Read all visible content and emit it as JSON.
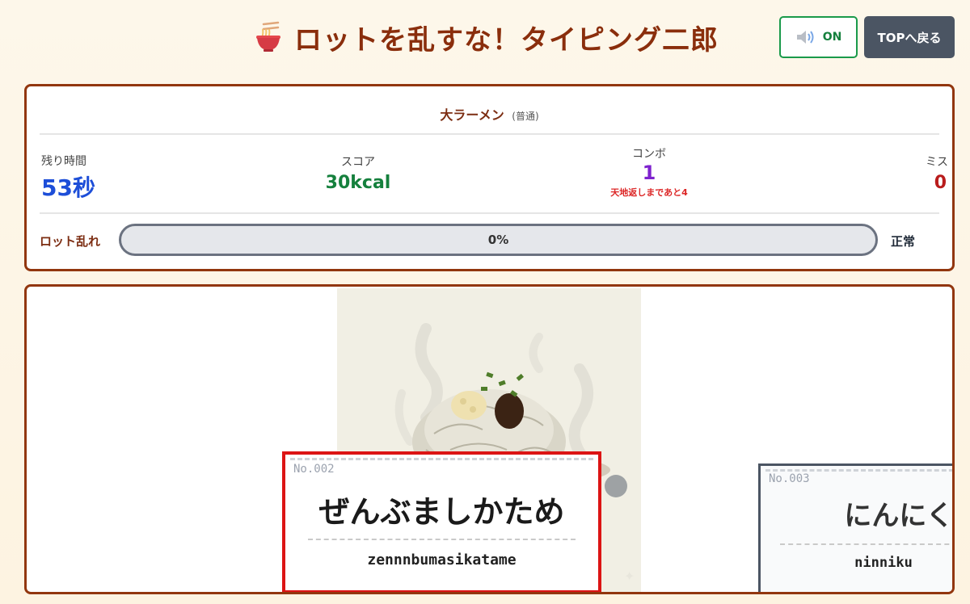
{
  "header": {
    "title": "ロットを乱すな！タイピング二郎",
    "sound_label": "ON",
    "top_button_label": "TOPへ戻る"
  },
  "status": {
    "course_name": "大ラーメン",
    "course_level": "(普通)",
    "time_label": "残り時間",
    "time_value": "53秒",
    "score_label": "スコア",
    "score_value": "30kcal",
    "combo_label": "コンボ",
    "combo_value": "1",
    "combo_note": "天地返しまであと4",
    "miss_label": "ミス",
    "miss_value": "0",
    "lot_label": "ロット乱れ",
    "lot_percent": 0,
    "lot_percent_text": "0%",
    "lot_state": "正常"
  },
  "cards": {
    "current": {
      "number": "No.002",
      "word": "ぜんぶましかため",
      "romaji": "zennnbumasikatame"
    },
    "next": {
      "number": "No.003",
      "word": "にんにく",
      "romaji": "ninniku"
    }
  },
  "colors": {
    "brand": "#8a2e0c",
    "time": "#1d4ed8",
    "score": "#15803d",
    "combo": "#7e22ce",
    "miss": "#b91c1c",
    "current_card_border": "#dc1414"
  },
  "icons": {
    "title_icon": "ramen-bowl-icon",
    "sound_icon": "speaker-icon"
  }
}
